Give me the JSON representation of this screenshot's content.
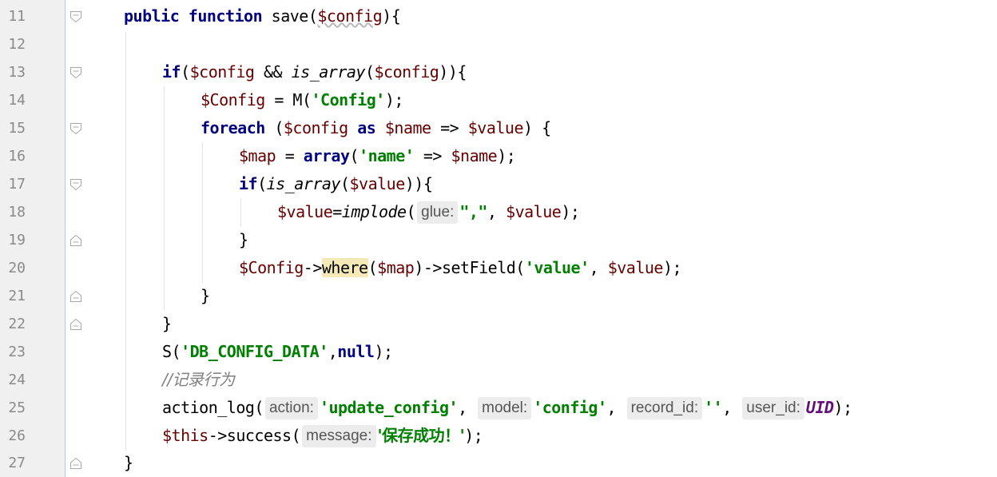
{
  "lines": [
    {
      "num": "11"
    },
    {
      "num": "12"
    },
    {
      "num": "13"
    },
    {
      "num": "14"
    },
    {
      "num": "15"
    },
    {
      "num": "16"
    },
    {
      "num": "17"
    },
    {
      "num": "18"
    },
    {
      "num": "19"
    },
    {
      "num": "20"
    },
    {
      "num": "21"
    },
    {
      "num": "22"
    },
    {
      "num": "23"
    },
    {
      "num": "24"
    },
    {
      "num": "25"
    },
    {
      "num": "26"
    },
    {
      "num": "27"
    }
  ],
  "code": {
    "l11": {
      "public": "public",
      "function": "function",
      "save": " save(",
      "config": "$config",
      "end": "){"
    },
    "l13": {
      "if": "if",
      "open": "(",
      "config1": "$config",
      "and": " && ",
      "is_array": "is_array",
      "open2": "(",
      "config2": "$config",
      "end": ")){"
    },
    "l14": {
      "var": "$Config",
      "eq": " = M(",
      "str": "'Config'",
      "end": ");"
    },
    "l15": {
      "foreach": "foreach",
      "open": " (",
      "config": "$config",
      "as": " as ",
      "name": "$name",
      "arrow": " => ",
      "value": "$value",
      "end": ") {"
    },
    "l16": {
      "map": "$map",
      "eq": " = ",
      "array": "array",
      "open": "(",
      "str": "'name'",
      "arrow": " => ",
      "name": "$name",
      "end": ");"
    },
    "l17": {
      "if": "if",
      "open": "(",
      "is_array": "is_array",
      "open2": "(",
      "value": "$value",
      "end": ")){"
    },
    "l18": {
      "value": "$value",
      "eq": "=",
      "implode": "implode",
      "open": "(",
      "param": "glue:",
      "str": "\",\"",
      "comma": ", ",
      "value2": "$value",
      "end": ");"
    },
    "l19": {
      "brace": "}"
    },
    "l20": {
      "config": "$Config",
      "arrow": "->",
      "where": "where",
      "open": "(",
      "map": "$map",
      "mid": ")->setField(",
      "str": "'value'",
      "comma": ", ",
      "value": "$value",
      "end": ");"
    },
    "l21": {
      "brace": "}"
    },
    "l22": {
      "brace": "}"
    },
    "l23": {
      "s": "S(",
      "str": "'DB_CONFIG_DATA'",
      "comma": ",",
      "null": "null",
      "end": ");"
    },
    "l24": {
      "comment": "//记录行为"
    },
    "l25": {
      "fn": "action_log(",
      "p1": "action:",
      "s1": "'update_config'",
      "c1": ", ",
      "p2": "model:",
      "s2": "'config'",
      "c2": ", ",
      "p3": "record_id:",
      "s3": "''",
      "c3": ", ",
      "p4": "user_id:",
      "uid": "UID",
      "end": ");"
    },
    "l26": {
      "this": "$this",
      "mid": "->success(",
      "p1": "message:",
      "str": "'保存成功！'",
      "end": ");"
    },
    "l27": {
      "brace": "}"
    }
  },
  "colors": {
    "keyword": "#000080",
    "variable": "#660000",
    "string": "#008000",
    "comment": "#808080",
    "constant": "#660e7a",
    "gutter": "#f0f0f0",
    "highlight": "#f5e9b8"
  },
  "icons": [
    "fold-open-icon",
    "fold-close-icon"
  ]
}
